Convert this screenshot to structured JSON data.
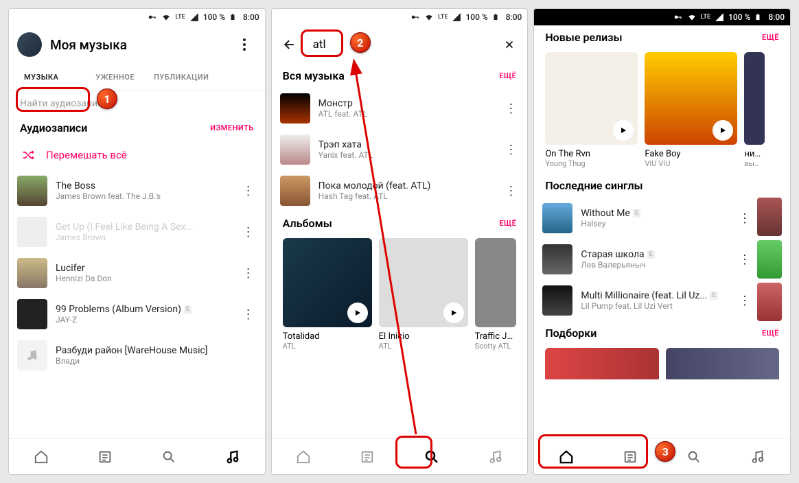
{
  "status": {
    "battery": "100 %",
    "time": "8:00",
    "net": "LTE"
  },
  "screen1": {
    "title": "Моя музыка",
    "tabs": [
      "МУЗЫКА",
      "ЗАГРУЖЕННОЕ",
      "ПУБЛИКАЦИИ"
    ],
    "tabs_partial": "УЖЕННОЕ",
    "search_placeholder": "Найти аудиозапись",
    "section_audio": "Аудиозаписи",
    "edit": "ИЗМЕНИТЬ",
    "shuffle": "Перемешать всё",
    "tracks": [
      {
        "title": "The Boss",
        "artist": "James Brown feat. The J.B.'s",
        "faded": false
      },
      {
        "title": "Get Up (I Feel Like Being A Sex...",
        "artist": "James Brown",
        "faded": true
      },
      {
        "title": "Lucifer",
        "artist": "Hennizi Da Don",
        "faded": false
      },
      {
        "title": "99 Problems (Album Version)",
        "artist": "JAY-Z",
        "faded": false,
        "explicit": true
      },
      {
        "title": "Разбуди район [WareHouse Music]",
        "artist": "Влади",
        "faded": false
      }
    ]
  },
  "screen2": {
    "query": "atl",
    "section_all": "Вся музыка",
    "more": "ЕЩЁ",
    "tracks": [
      {
        "title": "Монстр",
        "artist": "ATL feat. ATL"
      },
      {
        "title": "Трэп хата",
        "artist": "Yanix feat. ATL"
      },
      {
        "title": "Пока молодой (feat. ATL)",
        "artist": "Hash Tag feat. ATL"
      }
    ],
    "section_albums": "Альбомы",
    "albums": [
      {
        "title": "Totalidad",
        "artist": "ATL"
      },
      {
        "title": "El Inicio",
        "artist": "ATL"
      },
      {
        "title": "Traffic Ja...",
        "artist": "Scotty ATL"
      }
    ]
  },
  "screen3": {
    "section_new": "Новые релизы",
    "more": "ЕЩЁ",
    "releases": [
      {
        "title": "On The Rvn",
        "artist": "Young Thug"
      },
      {
        "title": "Fake Boy",
        "artist": "VIU VIU"
      },
      {
        "title": "никогда",
        "artist": "вышел"
      }
    ],
    "section_singles": "Последние синглы",
    "singles": [
      {
        "title": "Without Me",
        "artist": "Halsey",
        "explicit": true
      },
      {
        "title": "Старая школа",
        "artist": "Лев Валерьяныч",
        "explicit": true
      },
      {
        "title": "Multi Millionaire (feat. Lil Uz...",
        "artist": "Lil Pump feat. Lil Uzi Vert",
        "explicit": true
      }
    ],
    "section_collections": "Подборки"
  },
  "callouts": {
    "n1": "1",
    "n2": "2",
    "n3": "3"
  }
}
